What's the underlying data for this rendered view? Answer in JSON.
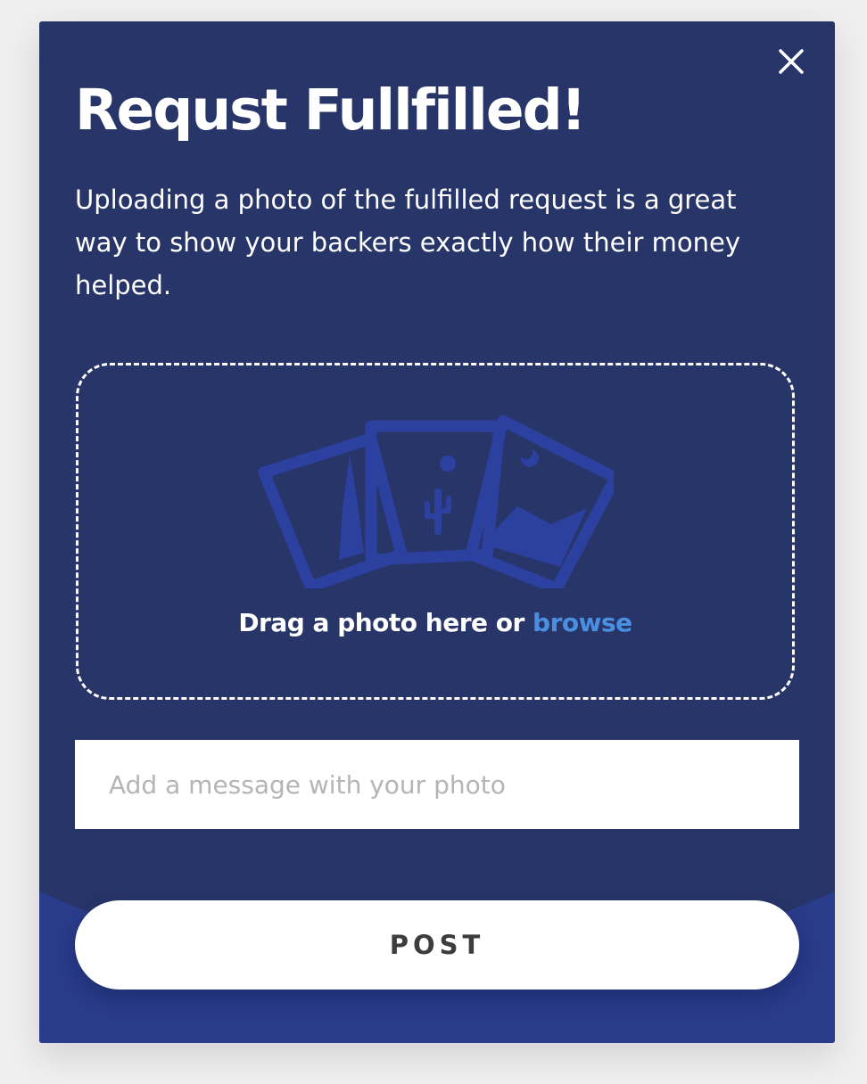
{
  "colors": {
    "modal_background": "#283569",
    "footer_wave": "#2a3c8c",
    "link": "#4a90e2",
    "placeholder": "#b5b5b5",
    "button_text": "#3d3d3d",
    "icon_tint": "#2c40a0"
  },
  "modal": {
    "title": "Requst Fullfilled!",
    "description": "Uploading a photo of the fulfilled request is a great way to show your backers exactly how their money helped.",
    "close_icon": "close-icon"
  },
  "dropzone": {
    "icon": "photos-icon",
    "text": "Drag a photo here or ",
    "link_text": "browse"
  },
  "message": {
    "placeholder": "Add a message with your photo",
    "value": ""
  },
  "actions": {
    "post_label": "POST"
  }
}
